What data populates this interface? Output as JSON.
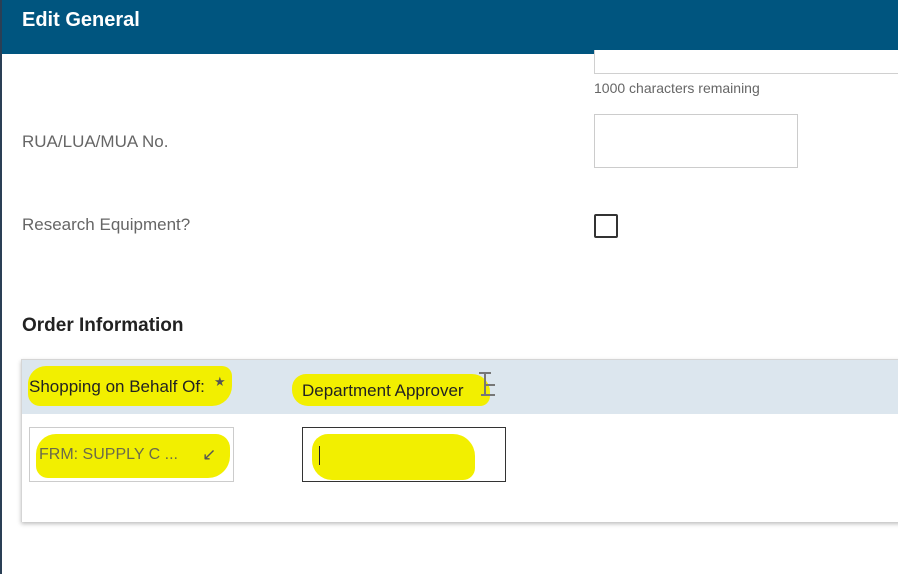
{
  "header": {
    "title": "Edit General"
  },
  "description": {
    "chars_remaining": "1000 characters remaining"
  },
  "fields": {
    "rua": {
      "label": "RUA/LUA/MUA No.",
      "value": ""
    },
    "research_equipment": {
      "label": "Research Equipment?",
      "checked": false
    }
  },
  "order_information": {
    "title": "Order Information",
    "columns": {
      "shopping_on_behalf_of": "Shopping on Behalf Of:",
      "required_mark": "★",
      "department_approver": "Department Approver"
    },
    "shopping_on_behalf_of_value": "FRM: SUPPLY C ...",
    "shopping_arrow_glyph": "↙",
    "department_approver_value": ""
  },
  "icons": {
    "shopping_arrow": "arrow-down-left-icon",
    "approver_filter": "column-filter-icon",
    "required": "star-icon"
  },
  "colors": {
    "header_bg": "#00557f",
    "highlight": "#f2ef00",
    "card_header_bg": "#dce6ee"
  }
}
